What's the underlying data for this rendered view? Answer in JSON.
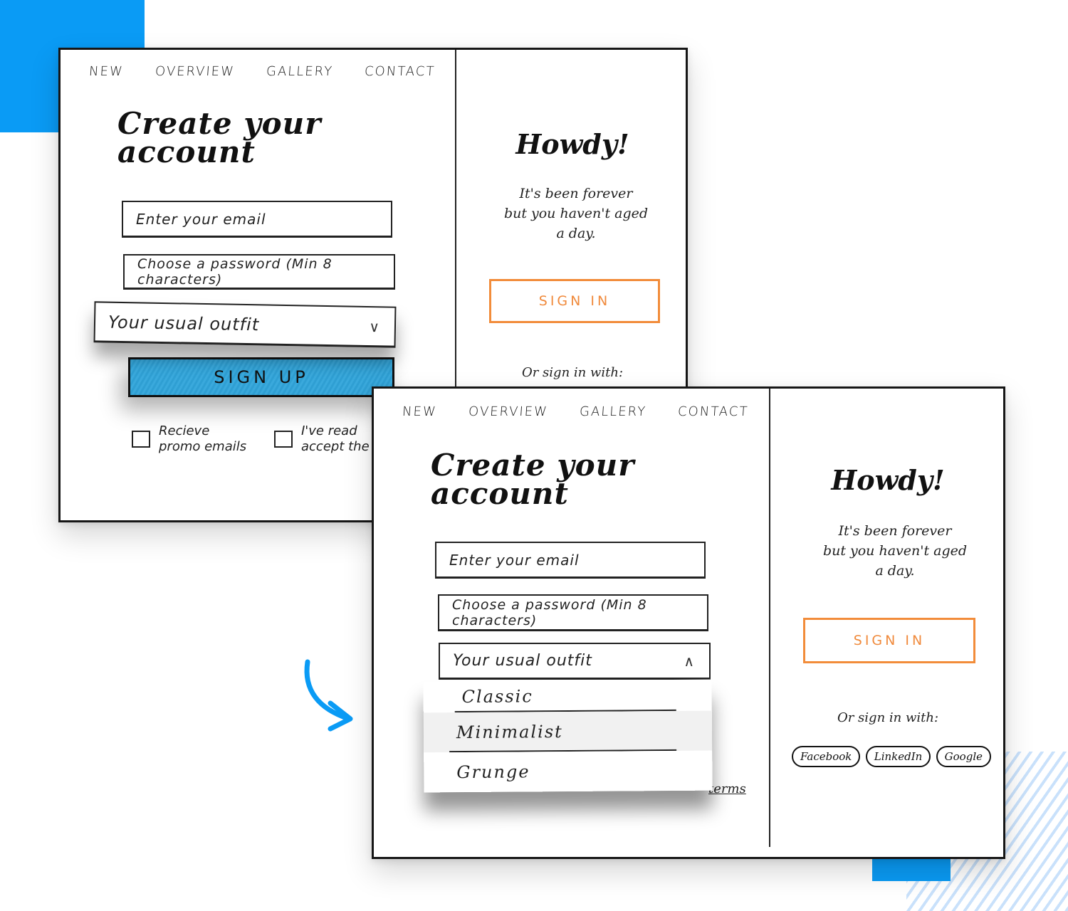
{
  "colors": {
    "accent_blue": "#0a9bf5",
    "signup_fill": "#3aa9dc",
    "signin_orange": "#f28c3a",
    "stripe_blue": "#c9e1fb",
    "ink": "#111111"
  },
  "before": {
    "nav": [
      "NEW",
      "OVERVIEW",
      "GALLERY",
      "CONTACT"
    ],
    "title_line1": "Create your",
    "title_line2": "account",
    "email_placeholder": "Enter your email",
    "password_placeholder": "Choose a password (Min 8 characters)",
    "outfit_select": {
      "placeholder": "Your usual outfit",
      "icon": "chevron-down-icon",
      "glyph": "∨",
      "expanded": false
    },
    "signup_label": "SIGN UP",
    "checkbox_promo": {
      "line1": "Recieve",
      "line2": "promo emails",
      "checked": false
    },
    "checkbox_terms": {
      "line1": "I've read",
      "line2": "accept the",
      "checked": false
    },
    "howdy": "Howdy!",
    "tagline_line1": "It's been forever",
    "tagline_line2": "but you haven't aged",
    "tagline_line3": "a day.",
    "signin_label": "SIGN IN",
    "or_sign_in_with": "Or sign in with:"
  },
  "after": {
    "nav": [
      "NEW",
      "OVERVIEW",
      "GALLERY",
      "CONTACT"
    ],
    "title_line1": "Create your",
    "title_line2": "account",
    "email_placeholder": "Enter your email",
    "password_placeholder": "Choose a password (Min 8 characters)",
    "outfit_select": {
      "placeholder": "Your usual outfit",
      "icon": "chevron-up-icon",
      "glyph": "∧",
      "expanded": true
    },
    "outfit_options": [
      {
        "label": "Classic",
        "highlighted": false
      },
      {
        "label": "Minimalist",
        "highlighted": true
      },
      {
        "label": "Grunge",
        "highlighted": false
      }
    ],
    "terms_fragment": "terms",
    "howdy": "Howdy!",
    "tagline_line1": "It's been forever",
    "tagline_line2": "but you haven't aged",
    "tagline_line3": "a day.",
    "signin_label": "SIGN IN",
    "or_sign_in_with": "Or sign in with:",
    "social_buttons": [
      "Facebook",
      "LinkedIn",
      "Google"
    ]
  },
  "transition_arrow": "curved-arrow-icon"
}
